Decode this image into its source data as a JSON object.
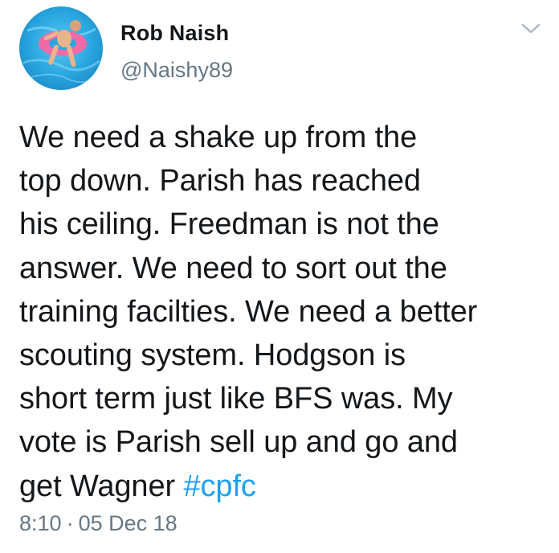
{
  "user": {
    "name": "Rob Naish",
    "handle": "@Naishy89"
  },
  "tweet": {
    "lines": [
      "We need a shake up from the",
      "top down. Parish has reached",
      "his ceiling. Freedman is not the",
      "answer. We need to sort out the",
      "training facilties. We need a better",
      "scouting system. Hodgson is",
      "short term just like BFS was. My",
      "vote is Parish sell up and go and"
    ],
    "last_line_text": "get Wagner ",
    "hashtag": "#cpfc"
  },
  "meta": {
    "time": "8:10",
    "separator": "·",
    "date": "05 Dec 18"
  },
  "icons": {
    "menu": "chevron-down-icon"
  },
  "colors": {
    "text": "#14171a",
    "secondary": "#657786",
    "link": "#1da1f2"
  }
}
